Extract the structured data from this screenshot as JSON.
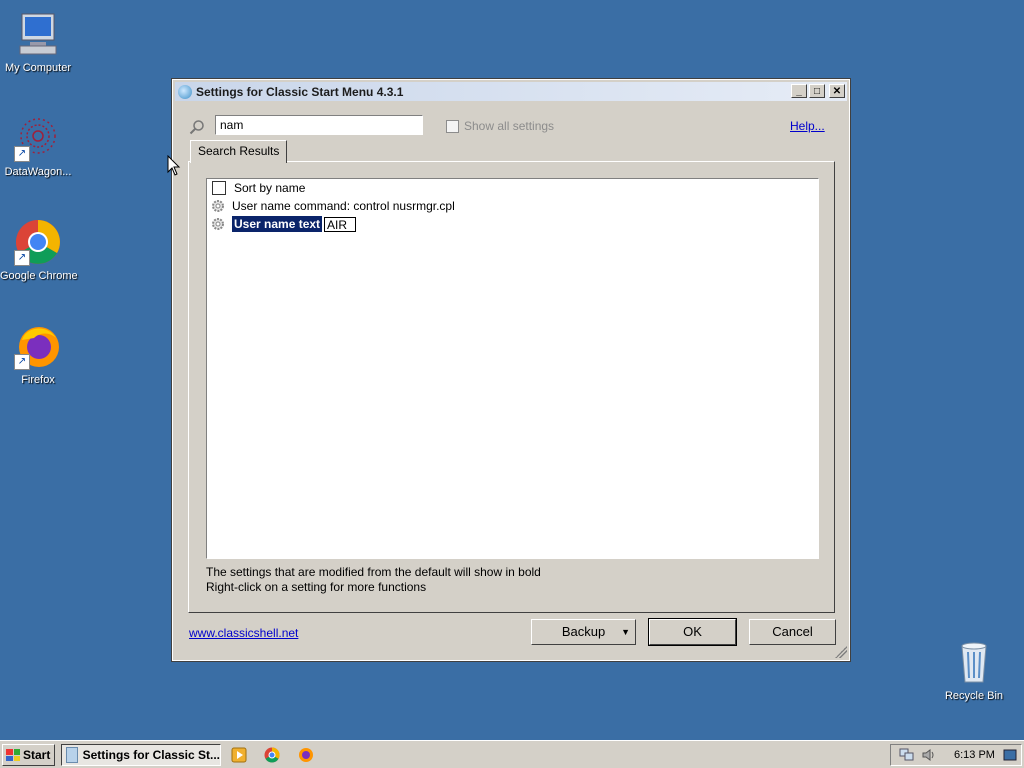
{
  "desktop": {
    "icons": [
      {
        "label": "My Computer",
        "icon": "computer-icon"
      },
      {
        "label": "DataWagon...",
        "icon": "datawagon-icon"
      },
      {
        "label": "Google Chrome",
        "icon": "chrome-icon"
      },
      {
        "label": "Firefox",
        "icon": "firefox-icon"
      },
      {
        "label": "Recycle Bin",
        "icon": "recycle-bin-icon"
      }
    ]
  },
  "window": {
    "title": "Settings for Classic Start Menu 4.3.1",
    "search_value": "nam",
    "show_all_label": "Show all settings",
    "help_label": "Help...",
    "tab_label": "Search Results",
    "rows": [
      {
        "label": "Sort by name",
        "type": "checkbox"
      },
      {
        "label": "User name command: control nusrmgr.cpl",
        "type": "setting"
      },
      {
        "label": "User name text",
        "type": "setting-edit",
        "edit_value": "AIR"
      }
    ],
    "info_lines": [
      "The settings that are modified from the default will show in bold",
      "Right-click on a setting for more functions"
    ],
    "site_link": "www.classicshell.net",
    "buttons": {
      "backup": "Backup",
      "ok": "OK",
      "cancel": "Cancel"
    }
  },
  "taskbar": {
    "start_label": "Start",
    "task_label": "Settings for Classic St...",
    "clock": "6:13 PM"
  }
}
